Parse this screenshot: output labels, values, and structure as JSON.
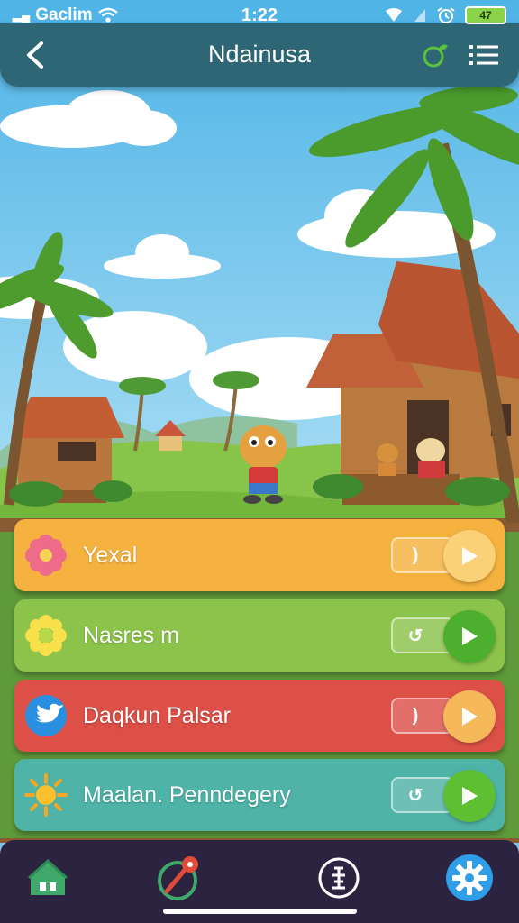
{
  "status_bar": {
    "carrier": "Gaclim",
    "time": "1:22",
    "battery": "47"
  },
  "header": {
    "title": "Ndainusa"
  },
  "cards": [
    {
      "label": "Yexal",
      "icon": "flower-icon",
      "pill_glyph": ")",
      "color": "#f5b23e",
      "play_color": "#fbd177"
    },
    {
      "label": "Nasres m",
      "icon": "sunflower-icon",
      "pill_glyph": "↺",
      "color": "#8cc34b",
      "play_color": "#4caf2e"
    },
    {
      "label": "Daqkun Palsar",
      "icon": "bird-icon",
      "pill_glyph": ")",
      "color": "#dc5048",
      "play_color": "#f5b95c"
    },
    {
      "label": "Maalan. Penndegery",
      "icon": "sun-icon",
      "pill_glyph": "↺",
      "color": "#4fb3a8",
      "play_color": "#5fbf32"
    }
  ],
  "bottom_nav": [
    {
      "name": "home",
      "icon": "home-icon"
    },
    {
      "name": "compass",
      "icon": "compass-icon"
    },
    {
      "name": "info",
      "icon": "info-icon"
    },
    {
      "name": "settings",
      "icon": "gear-icon"
    }
  ]
}
